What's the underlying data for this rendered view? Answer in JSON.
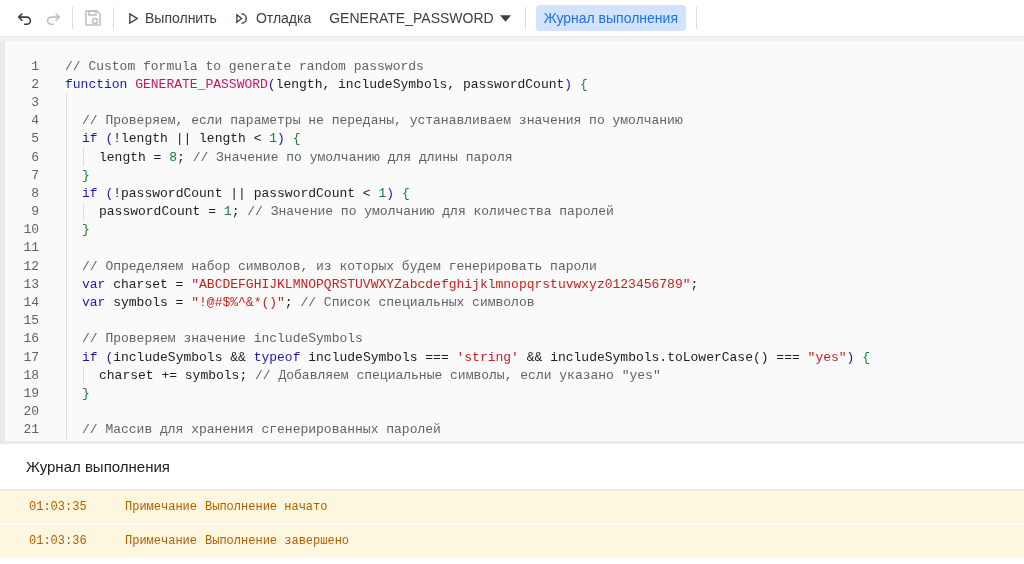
{
  "toolbar": {
    "run_label": "Выполнить",
    "debug_label": "Отладка",
    "function_select": "GENERATE_PASSWORD",
    "log_button": {
      "label": "Журнал выполнения",
      "selected": true
    },
    "redo_disabled": true,
    "save_disabled": true
  },
  "code": [
    {
      "number": "1",
      "tokens": [
        {
          "kind": "comment",
          "text": "// Custom formula to generate random passwords"
        }
      ]
    },
    {
      "number": "2",
      "tokens": [
        {
          "kind": "keyword",
          "text": "function "
        },
        {
          "kind": "function",
          "text": "GENERATE_PASSWORD"
        },
        {
          "kind": "paren",
          "text": "("
        },
        {
          "kind": "plain",
          "text": "length, includeSymbols, passwordCount"
        },
        {
          "kind": "paren",
          "text": ")"
        },
        {
          "kind": "brace",
          "text": " {"
        }
      ]
    },
    {
      "number": "3"
    },
    {
      "number": "4",
      "tokens": [
        {
          "kind": "comment",
          "text": "  // Проверяем, если параметры не переданы, устанавливаем значения по умолчанию"
        }
      ]
    },
    {
      "number": "5",
      "tokens": [
        {
          "kind": "keyword",
          "text": "  if "
        },
        {
          "kind": "paren",
          "text": "("
        },
        {
          "kind": "plain",
          "text": "!length || length < "
        },
        {
          "kind": "number",
          "text": "1"
        },
        {
          "kind": "paren",
          "text": ")"
        },
        {
          "kind": "brace",
          "text": " {"
        }
      ]
    },
    {
      "number": "6",
      "tokens": [
        {
          "kind": "plain",
          "text": "    length = "
        },
        {
          "kind": "number",
          "text": "8"
        },
        {
          "kind": "plain",
          "text": "; "
        },
        {
          "kind": "comment",
          "text": "// Значение по умолчанию для длины пароля"
        }
      ]
    },
    {
      "number": "7",
      "tokens": [
        {
          "kind": "brace",
          "text": "  }"
        }
      ]
    },
    {
      "number": "8",
      "tokens": [
        {
          "kind": "keyword",
          "text": "  if "
        },
        {
          "kind": "paren",
          "text": "("
        },
        {
          "kind": "plain",
          "text": "!passwordCount || passwordCount < "
        },
        {
          "kind": "number",
          "text": "1"
        },
        {
          "kind": "paren",
          "text": ")"
        },
        {
          "kind": "brace",
          "text": " {"
        }
      ]
    },
    {
      "number": "9",
      "tokens": [
        {
          "kind": "plain",
          "text": "    passwordCount = "
        },
        {
          "kind": "number",
          "text": "1"
        },
        {
          "kind": "plain",
          "text": "; "
        },
        {
          "kind": "comment",
          "text": "// Значение по умолчанию для количества паролей"
        }
      ]
    },
    {
      "number": "10",
      "tokens": [
        {
          "kind": "brace",
          "text": "  }"
        }
      ]
    },
    {
      "number": "11"
    },
    {
      "number": "12",
      "tokens": [
        {
          "kind": "comment",
          "text": "  // Определяем набор символов, из которых будем генерировать пароли"
        }
      ]
    },
    {
      "number": "13",
      "tokens": [
        {
          "kind": "keyword",
          "text": "  var"
        },
        {
          "kind": "plain",
          "text": " charset = "
        },
        {
          "kind": "string",
          "text": "\"ABCDEFGHIJKLMNOPQRSTUVWXYZabcdefghijklmnopqrstuvwxyz0123456789\""
        },
        {
          "kind": "plain",
          "text": ";"
        }
      ]
    },
    {
      "number": "14",
      "tokens": [
        {
          "kind": "keyword",
          "text": "  var"
        },
        {
          "kind": "plain",
          "text": " symbols = "
        },
        {
          "kind": "string",
          "text": "\"!@#$%^&*()\""
        },
        {
          "kind": "plain",
          "text": "; "
        },
        {
          "kind": "comment",
          "text": "// Список специальных символов"
        }
      ]
    },
    {
      "number": "15"
    },
    {
      "number": "16",
      "tokens": [
        {
          "kind": "comment",
          "text": "  // Проверяем значение includeSymbols"
        }
      ]
    },
    {
      "number": "17",
      "tokens": [
        {
          "kind": "keyword",
          "text": "  if "
        },
        {
          "kind": "paren",
          "text": "("
        },
        {
          "kind": "plain",
          "text": "includeSymbols && "
        },
        {
          "kind": "keyword",
          "text": "typeof"
        },
        {
          "kind": "plain",
          "text": " includeSymbols === "
        },
        {
          "kind": "string",
          "text": "'string'"
        },
        {
          "kind": "plain",
          "text": " && includeSymbols.toLowerCase() === "
        },
        {
          "kind": "string",
          "text": "\"yes\""
        },
        {
          "kind": "paren",
          "text": ")"
        },
        {
          "kind": "brace",
          "text": " {"
        }
      ]
    },
    {
      "number": "18",
      "tokens": [
        {
          "kind": "plain",
          "text": "    charset += symbols; "
        },
        {
          "kind": "comment",
          "text": "// Добавляем специальные символы, если указано \"yes\""
        }
      ]
    },
    {
      "number": "19",
      "tokens": [
        {
          "kind": "brace",
          "text": "  }"
        }
      ]
    },
    {
      "number": "20"
    },
    {
      "number": "21",
      "tokens": [
        {
          "kind": "comment",
          "text": "  // Массив для хранения сгенерированных паролей"
        }
      ]
    }
  ],
  "log": {
    "title": "Журнал выполнения",
    "entries": [
      {
        "time": "01:03:35",
        "level": "Примечание",
        "message": "Выполнение начато"
      },
      {
        "time": "01:03:36",
        "level": "Примечание",
        "message": "Выполнение завершено"
      }
    ]
  }
}
